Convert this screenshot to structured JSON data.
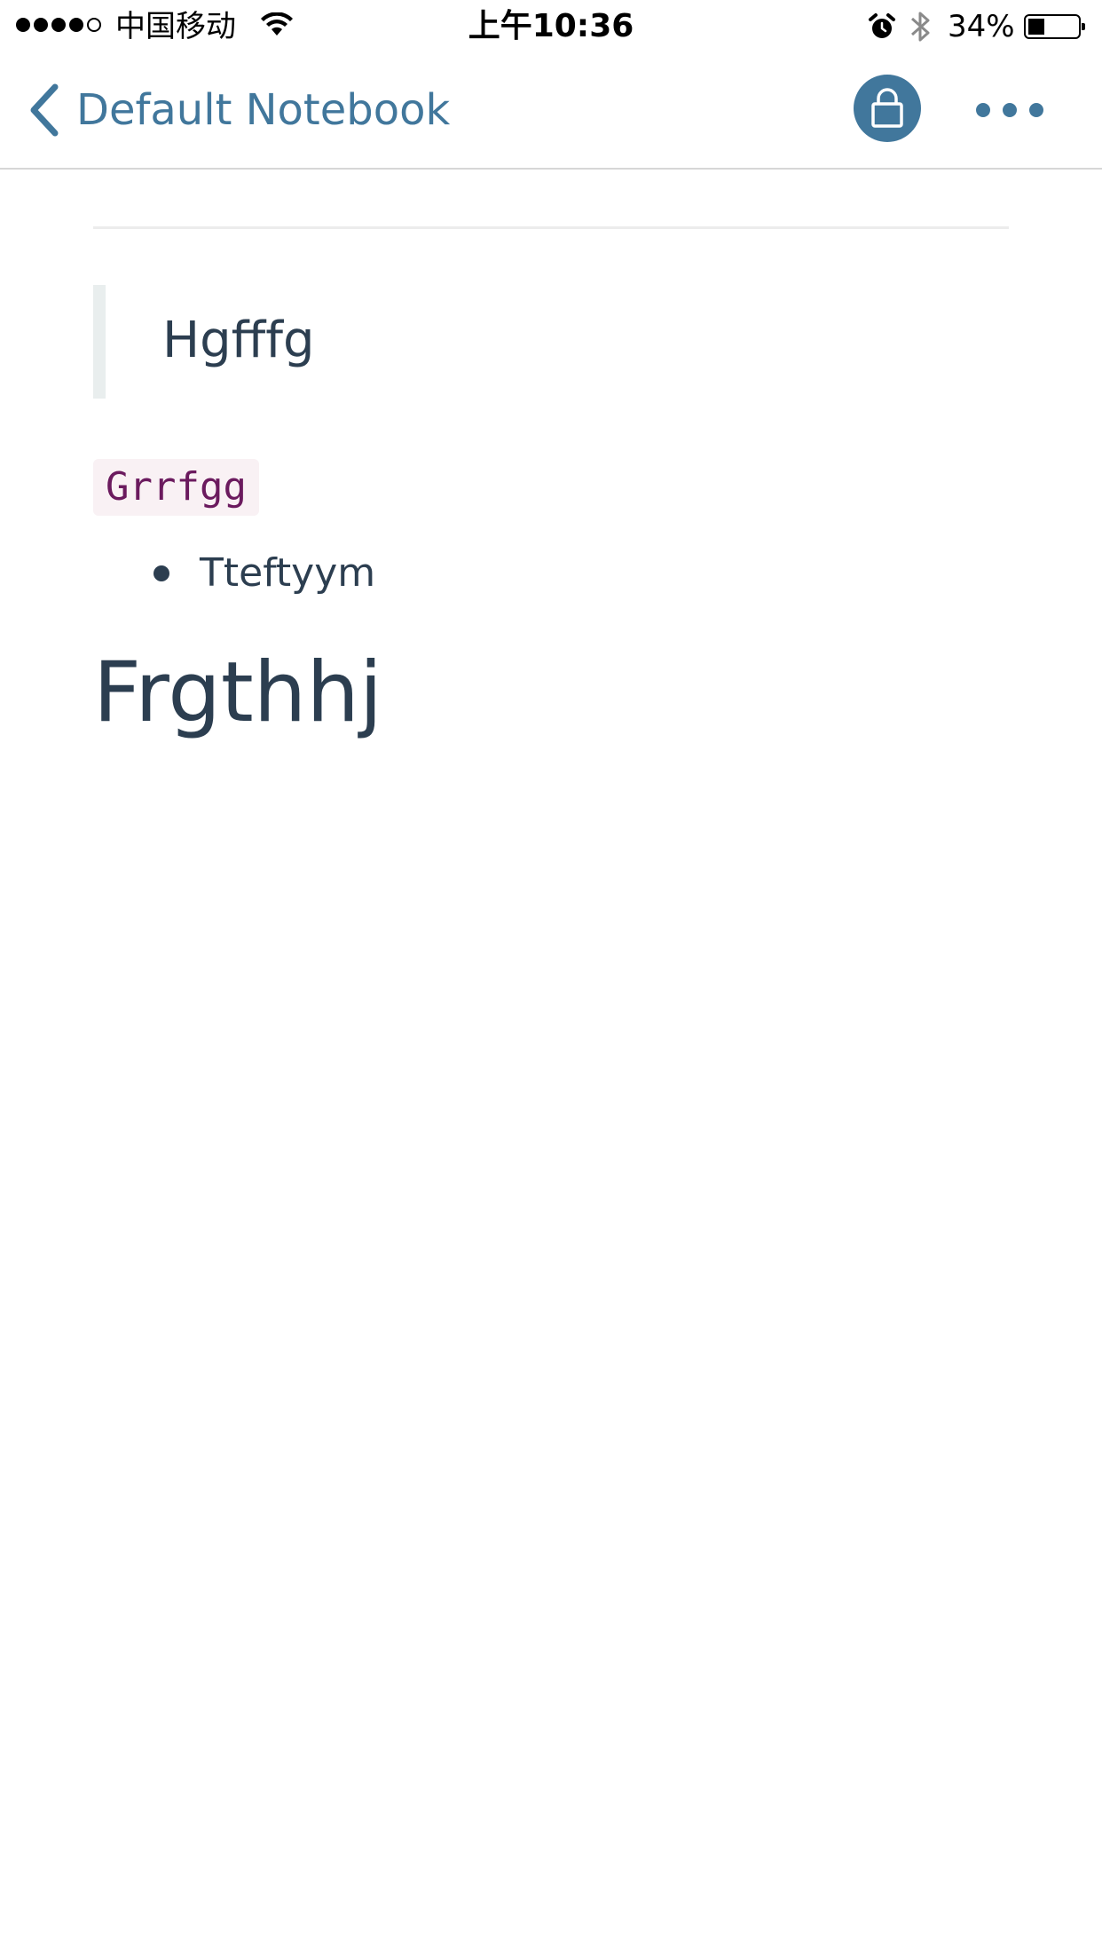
{
  "status_bar": {
    "carrier": "中国移动",
    "time": "上午10:36",
    "battery": "34%",
    "battery_level": 0.34,
    "signal_bars_filled": 4,
    "signal_bars_total": 5
  },
  "nav": {
    "back_label": "Default Notebook",
    "lock_icon": "lock-icon",
    "more_icon": "more-icon"
  },
  "note": {
    "blockquote": "Hgfffg",
    "inline_code": "Grrfgg",
    "list_items": [
      "Tteftyym"
    ],
    "heading": "Frgthhj"
  },
  "colors": {
    "accent": "#41779c",
    "text": "#2c3e50",
    "code_text": "#6b1a5e",
    "code_bg": "#f9f1f4",
    "quote_border": "#e9eeee"
  }
}
